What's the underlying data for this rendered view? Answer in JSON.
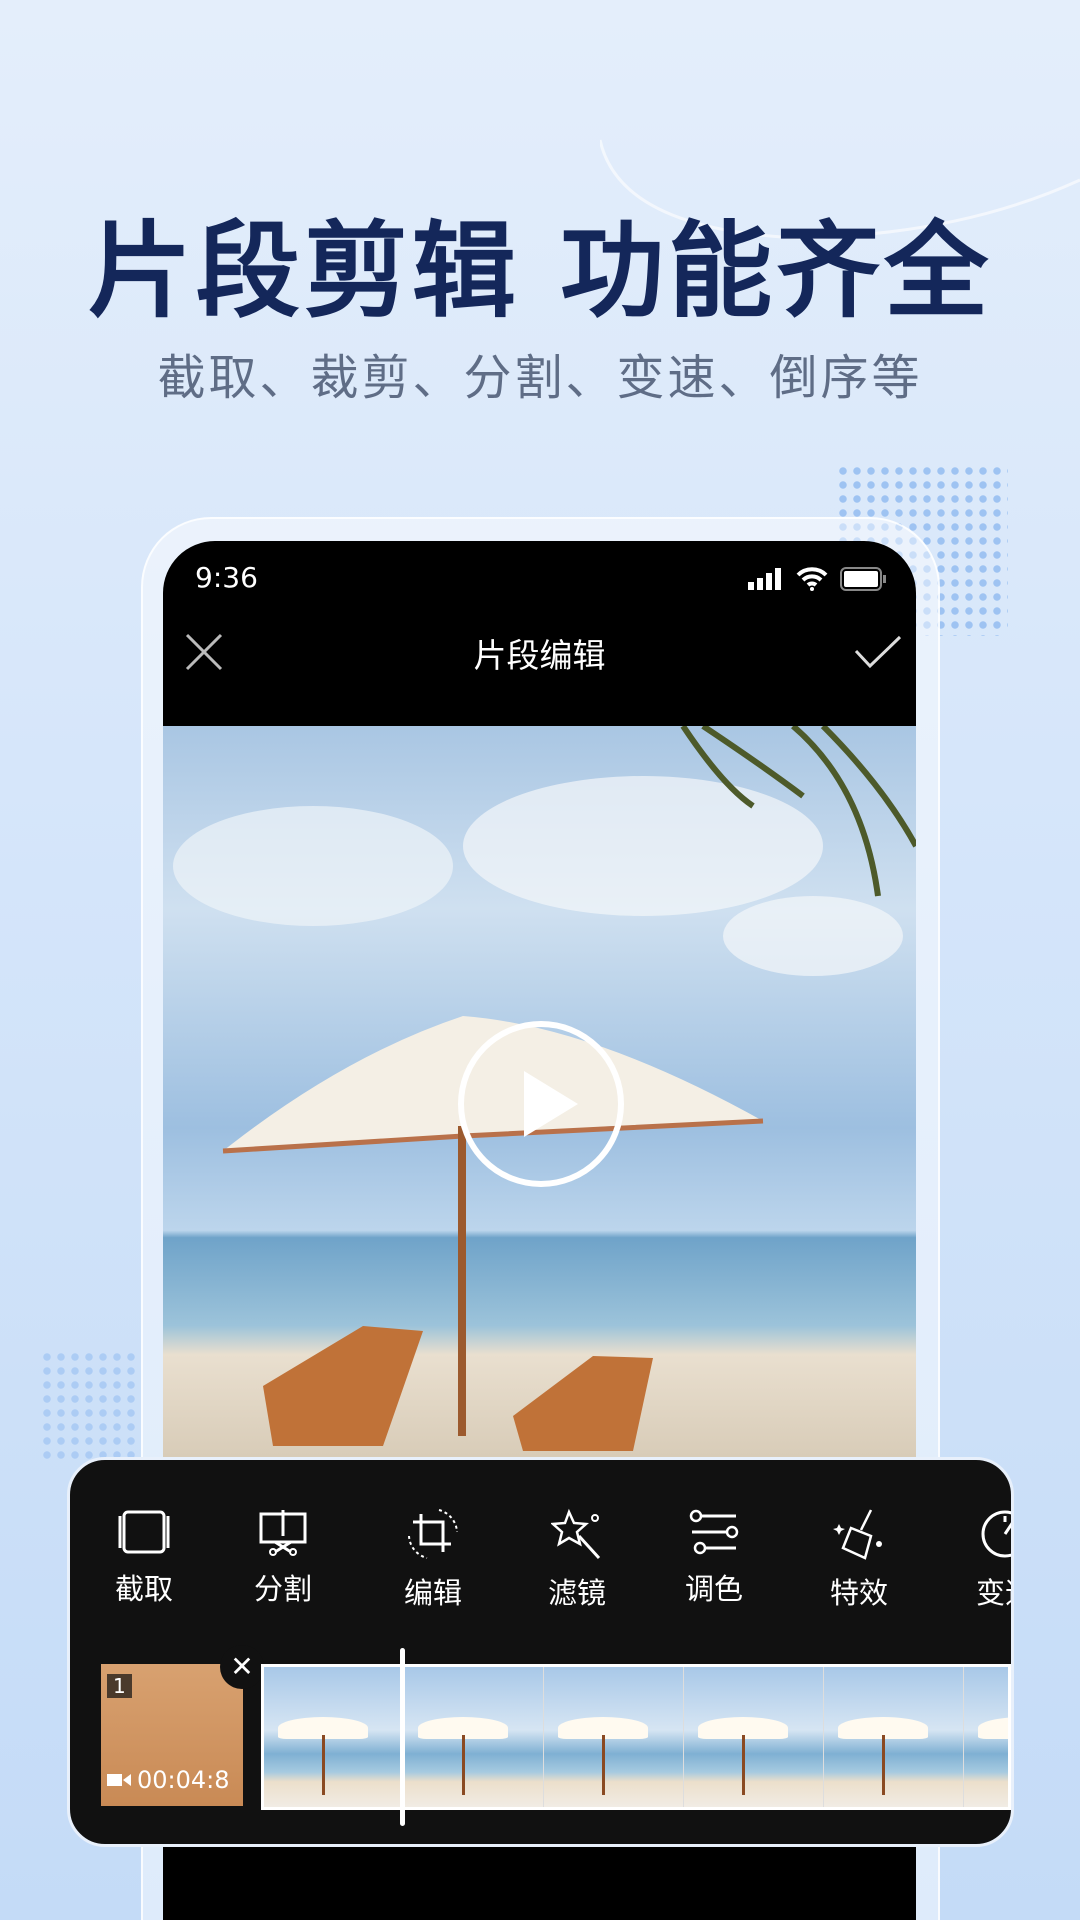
{
  "headline": "片段剪辑 功能齐全",
  "subtitle": "截取、裁剪、分割、变速、倒序等",
  "phone": {
    "status": {
      "time": "9:36"
    },
    "nav": {
      "title": "片段编辑",
      "close_icon": "close-icon",
      "confirm_icon": "check-icon"
    },
    "player": {
      "play_icon": "play-icon"
    },
    "tools": [
      {
        "label": "截取",
        "icon": "trim-icon"
      },
      {
        "label": "分割",
        "icon": "split-scissors-icon"
      },
      {
        "label": "编辑",
        "icon": "crop-rotate-icon"
      },
      {
        "label": "滤镜",
        "icon": "magic-wand-icon"
      },
      {
        "label": "调色",
        "icon": "sliders-icon"
      },
      {
        "label": "特效",
        "icon": "broom-sparkle-icon"
      },
      {
        "label": "变速",
        "icon": "speedometer-icon"
      }
    ],
    "clip": {
      "index": "1",
      "duration": "00:04:8"
    }
  }
}
